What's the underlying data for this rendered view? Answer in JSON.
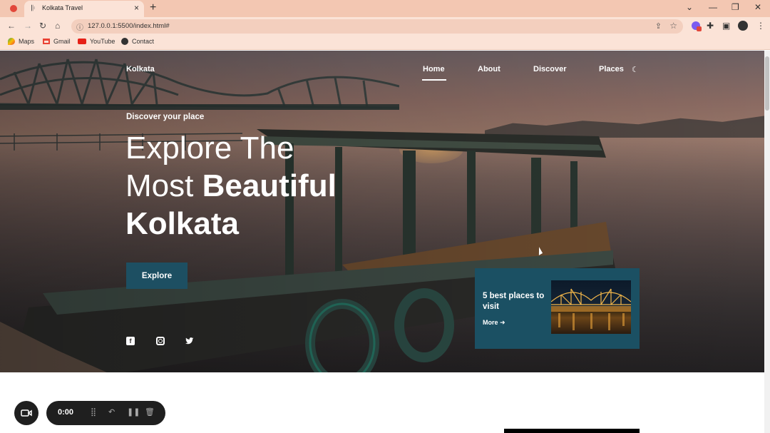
{
  "browser": {
    "tab_title": "Kolkata Travel",
    "url": "127.0.0.1:5500/index.html#",
    "new_tab": "+",
    "bookmarks": [
      {
        "label": "Maps",
        "icon": "maps-icon"
      },
      {
        "label": "Gmail",
        "icon": "gmail-icon"
      },
      {
        "label": "YouTube",
        "icon": "youtube-icon"
      },
      {
        "label": "Contact",
        "icon": "globe-icon"
      }
    ]
  },
  "site": {
    "brand": "Kolkata",
    "nav": [
      {
        "label": "Home",
        "active": true
      },
      {
        "label": "About"
      },
      {
        "label": "Discover"
      },
      {
        "label": "Places"
      }
    ],
    "hero": {
      "subtitle": "Discover your place",
      "headline_line1": "Explore The",
      "headline_line2_light": "Most ",
      "headline_line2_bold": "Beautiful",
      "headline_line3": "Kolkata",
      "button": "Explore"
    },
    "card": {
      "title": "5 best places to visit",
      "more": "More"
    },
    "socials": [
      "facebook-icon",
      "instagram-icon",
      "twitter-icon"
    ]
  },
  "recorder": {
    "time": "0:00"
  },
  "colors": {
    "accent": "#1b5063",
    "tabbar": "#f3c7b2",
    "toolbar": "#fbe3d7"
  }
}
